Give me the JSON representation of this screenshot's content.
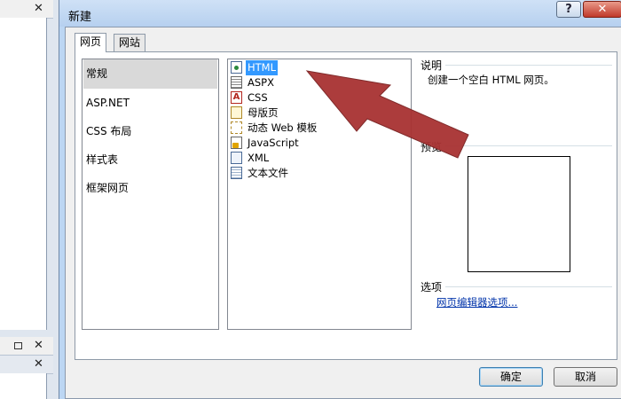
{
  "background_panels": {
    "top_close": "✕",
    "bottom_close_1": "✕",
    "bottom_close_2": "✕"
  },
  "dialog": {
    "title": "新建",
    "help_button": "?",
    "close_button": "✕",
    "tabs": [
      {
        "label": "网页",
        "active": true
      },
      {
        "label": "网站",
        "active": false
      }
    ],
    "categories": [
      {
        "label": "常规",
        "selected": true
      },
      {
        "label": "ASP.NET",
        "selected": false
      },
      {
        "label": "CSS 布局",
        "selected": false
      },
      {
        "label": "样式表",
        "selected": false
      },
      {
        "label": "框架网页",
        "selected": false
      }
    ],
    "templates": [
      {
        "label": "HTML",
        "icon": "html-page-icon",
        "selected": true
      },
      {
        "label": "ASPX",
        "icon": "aspx-page-icon",
        "selected": false
      },
      {
        "label": "CSS",
        "icon": "css-file-icon",
        "selected": false
      },
      {
        "label": "母版页",
        "icon": "master-page-icon",
        "selected": false
      },
      {
        "label": "动态 Web 模板",
        "icon": "dynamic-template-icon",
        "selected": false
      },
      {
        "label": "JavaScript",
        "icon": "javascript-file-icon",
        "selected": false
      },
      {
        "label": "XML",
        "icon": "xml-file-icon",
        "selected": false
      },
      {
        "label": "文本文件",
        "icon": "text-file-icon",
        "selected": false
      }
    ],
    "description_label": "说明",
    "description_text": "创建一个空白 HTML 网页。",
    "preview_label": "预览",
    "options_label": "选项",
    "options_link": "网页编辑器选项...",
    "ok_button": "确定",
    "cancel_button": "取消",
    "annotation_arrow_color": "#a83232",
    "selection_color": "#3399ff"
  }
}
